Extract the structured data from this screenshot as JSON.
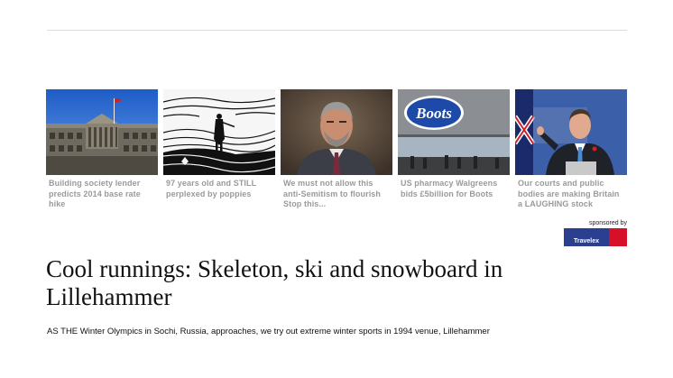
{
  "related": [
    {
      "caption": "Building society lender predicts 2014 base rate hike",
      "image": "bank-of-england-photo"
    },
    {
      "caption": "97 years old and STILL perplexed by poppies",
      "image": "woodcut-illustration"
    },
    {
      "caption": "We must not allow this anti-Semitism to flourish Stop this...",
      "image": "politician-portrait-photo"
    },
    {
      "caption": "US pharmacy Walgreens bids £5billion for Boots",
      "image": "boots-store-photo"
    },
    {
      "caption": "Our courts and public bodies are making Britain a LAUGHING stock",
      "image": "prime-minister-photo"
    }
  ],
  "sponsor": {
    "label": "sponsored by",
    "brand": "Travelex",
    "colors": {
      "blue": "#2a3f8f",
      "red": "#d7102a"
    }
  },
  "article": {
    "headline": "Cool runnings: Skeleton, ski and snowboard in Lillehammer",
    "standfirst": "AS THE Winter Olympics in Sochi, Russia, approaches, we try out extreme winter sports in 1994 venue, Lillehammer"
  }
}
